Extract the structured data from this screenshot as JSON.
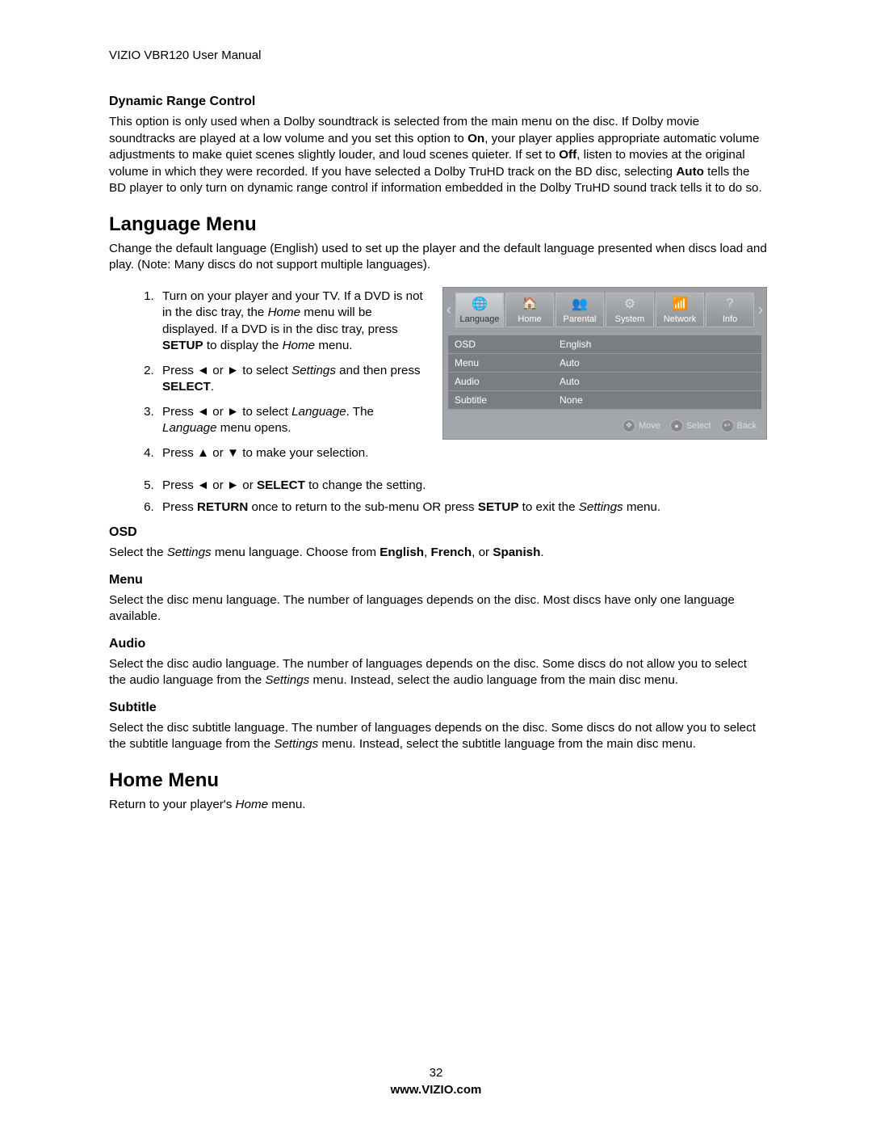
{
  "header": "VIZIO VBR120 User Manual",
  "drc": {
    "heading": "Dynamic Range Control",
    "text_parts": [
      "This option is only used when a Dolby soundtrack is selected from the main menu on the disc. If Dolby movie soundtracks are played at a low volume and you set this option to ",
      "On",
      ", your player applies appropriate automatic volume adjustments to make quiet scenes slightly louder, and loud scenes quieter. If set to ",
      "Off",
      ", listen to movies at the original volume in which they were recorded. If you have selected a Dolby TruHD track on the BD disc, selecting ",
      "Auto",
      " tells the BD player to only turn on dynamic range control if information embedded in the Dolby TruHD sound track tells it to do so."
    ]
  },
  "lang_menu": {
    "heading": "Language Menu",
    "intro": "Change the default language (English) used to set up the player and the default language presented when discs load and play. (Note: Many discs do not support multiple languages).",
    "steps": {
      "s1_p": [
        "Turn on your player and your TV. If a DVD is not in the disc tray, the ",
        "Home",
        " menu will be displayed. If a DVD is in the disc tray, press ",
        "SETUP",
        " to display the ",
        "Home",
        " menu."
      ],
      "s2_p": [
        "Press ◄ or ► to select ",
        "Settings",
        " and then press ",
        "SELECT",
        "."
      ],
      "s3_p": [
        "Press ◄ or ► to select ",
        "Language",
        ". The ",
        "Language",
        " menu opens."
      ],
      "s4": "Press ▲ or ▼ to make your selection.",
      "s5_p": [
        "Press ◄ or ► or ",
        "SELECT",
        " to change the setting."
      ],
      "s6_p": [
        "Press ",
        "RETURN",
        " once to return to the sub-menu OR press ",
        "SETUP",
        " to exit the ",
        "Settings",
        " menu."
      ]
    }
  },
  "ui": {
    "tabs": [
      "Language",
      "Home",
      "Parental",
      "System",
      "Network",
      "Info"
    ],
    "tab_icons": [
      "🌐",
      "🏠",
      "👥",
      "⚙",
      "📶",
      "?"
    ],
    "selected_tab": 0,
    "rows": [
      {
        "key": "OSD",
        "val": "English"
      },
      {
        "key": "Menu",
        "val": "Auto"
      },
      {
        "key": "Audio",
        "val": "Auto"
      },
      {
        "key": "Subtitle",
        "val": "None"
      }
    ],
    "footer": [
      "Move",
      "Select",
      "Back"
    ]
  },
  "osd": {
    "heading": "OSD",
    "text_p": [
      "Select the ",
      "Settings",
      " menu language. Choose from ",
      "English",
      ", ",
      "French",
      ", or ",
      "Spanish",
      "."
    ]
  },
  "menu_sec": {
    "heading": "Menu",
    "text": "Select the disc menu language. The number of languages depends on the disc. Most discs have only one language available."
  },
  "audio_sec": {
    "heading": "Audio",
    "text_p": [
      "Select the disc audio language. The number of languages depends on the disc. Some discs do not allow you to select the audio language from the ",
      "Settings",
      " menu. Instead, select the audio language from the main disc menu."
    ]
  },
  "subtitle_sec": {
    "heading": "Subtitle",
    "text_p": [
      "Select the disc subtitle language. The number of languages depends on the disc. Some discs do not allow you to select the subtitle language from the ",
      "Settings",
      " menu. Instead, select the subtitle language from the main disc menu."
    ]
  },
  "home_menu": {
    "heading": "Home Menu",
    "text_p": [
      "Return to your player's ",
      "Home",
      " menu."
    ]
  },
  "footer": {
    "page_num": "32",
    "url": "www.VIZIO.com"
  }
}
